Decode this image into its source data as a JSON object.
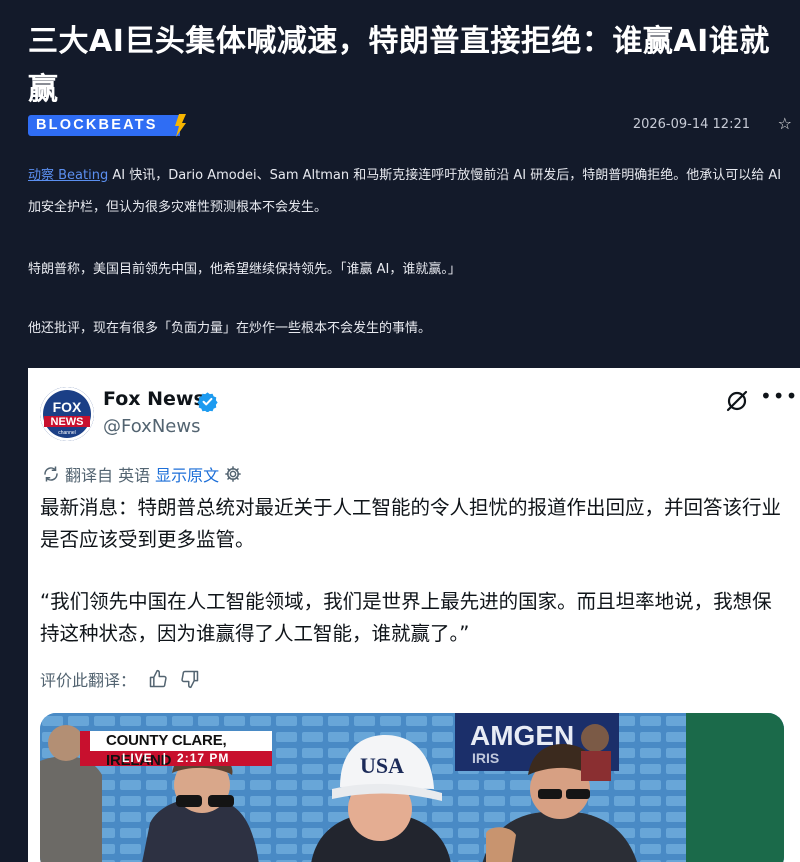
{
  "article": {
    "title": "三大AI巨头集体喊减速，特朗普直接拒绝：谁赢AI谁就赢",
    "source_logo": "BLOCKBEATS",
    "timestamp": "2026-09-14 12:21",
    "favorite_icon": "star-icon",
    "p1_link": "动察 Beating",
    "p1_text": " AI 快讯，Dario Amodei、Sam Altman 和马斯克接连呼吁放慢前沿 AI 研发后，特朗普明确拒绝。他承认可以给 AI 加安全护栏，但认为很多灾难性预测根本不会发生。",
    "p2_text": "特朗普称，美国目前领先中国，他希望继续保持领先。「谁赢 AI，谁就赢。」",
    "p3_text": "他还批评，现在有很多「负面力量」在炒作一些根本不会发生的事情。"
  },
  "tweet": {
    "author_name": "Fox News",
    "handle": "@FoxNews",
    "avatar_text_1": "FOX",
    "avatar_text_2": "NEWS",
    "avatar_text_3": "channel",
    "translated_from": "翻译自 英语",
    "show_original": "显示原文",
    "body_1": "最新消息：特朗普总统对最近关于人工智能的令人担忧的报道作出回应，并回答该行业是否应该受到更多监管。",
    "body_2": "“我们领先中国在人工智能领域，我们是世界上最先进的国家。而且坦率地说，我想保持这种状态，因为谁赢得了人工智能，谁就赢了。”",
    "rate_translation": "评价此翻译：",
    "media": {
      "chyron_location": "COUNTY CLARE, IRELAND",
      "chyron_live": "LIVE",
      "chyron_time": "2:17 PM",
      "banner_text": "AMGEN",
      "banner_sub": "IRIS",
      "cap_text": "USA"
    }
  },
  "colors": {
    "page_bg": "#131a2a",
    "link": "#5b8ff0",
    "logo_blue": "#2f6df4",
    "logo_bolt": "#f7b500",
    "verified_blue": "#1d9bf0",
    "chyron_red": "#c8102e"
  }
}
